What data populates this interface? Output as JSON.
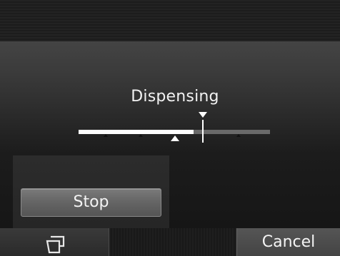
{
  "status": {
    "label": "Dispensing",
    "progress_fraction": 0.6
  },
  "controls": {
    "stop_label": "Stop"
  },
  "bottom_bar": {
    "left_icon": "cups-icon",
    "cancel_label": "Cancel"
  },
  "colors": {
    "progress_fill": "#ffffff",
    "progress_track": "#6a6a6a",
    "text": "#f2f2f2"
  }
}
